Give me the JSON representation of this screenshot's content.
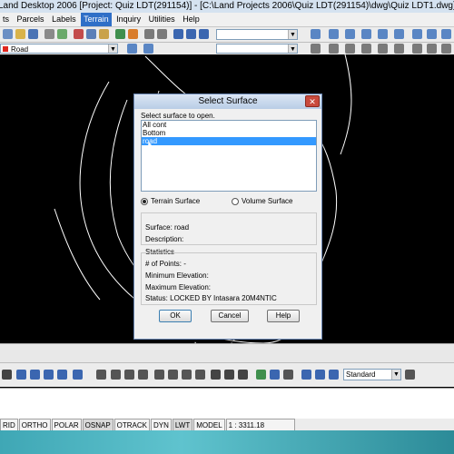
{
  "window": {
    "title": "Land Desktop 2006 [Project: Quiz LDT(291154)] - [C:\\Land Projects 2006\\Quiz LDT(291154)\\dwg\\Quiz LDT1.dwg]"
  },
  "menu": {
    "items": [
      "ts",
      "Parcels",
      "Labels",
      "Terrain",
      "Inquiry",
      "Utilities",
      "Help"
    ],
    "active": "Terrain"
  },
  "layer_toolbar": {
    "layer_name": "Road"
  },
  "dialog": {
    "title": "Select Surface",
    "close_label": "✕",
    "prompt": "Select surface to open.",
    "surfaces": [
      "All cont",
      "Bottom",
      "road"
    ],
    "selected_index": 2,
    "surface_type_terrain": "Terrain Surface",
    "surface_type_volume": "Volume Surface",
    "surface_label": "Surface: road",
    "description_label": "Description:",
    "statistics_label": "Statistics",
    "points_label": "# of Points: -",
    "min_elev_label": "Minimum Elevation:",
    "max_elev_label": "Maximum Elevation:",
    "status_label": "Status: LOCKED BY Intasara 20M4NTIC",
    "ok_label": "OK",
    "cancel_label": "Cancel",
    "help_label": "Help"
  },
  "bottom_toolbar": {
    "dimstyle": "Standard"
  },
  "statusbar": {
    "buttons": [
      "RID",
      "ORTHO",
      "POLAR",
      "OSNAP",
      "OTRACK",
      "DYN",
      "LWT",
      "MODEL"
    ],
    "on_buttons": [
      "OSNAP",
      "LWT"
    ],
    "scale": "1 : 3311.18"
  },
  "colors": {
    "drawing_bg": "#000000",
    "selection": "#3399ff",
    "layer_color": "#e0271f"
  }
}
